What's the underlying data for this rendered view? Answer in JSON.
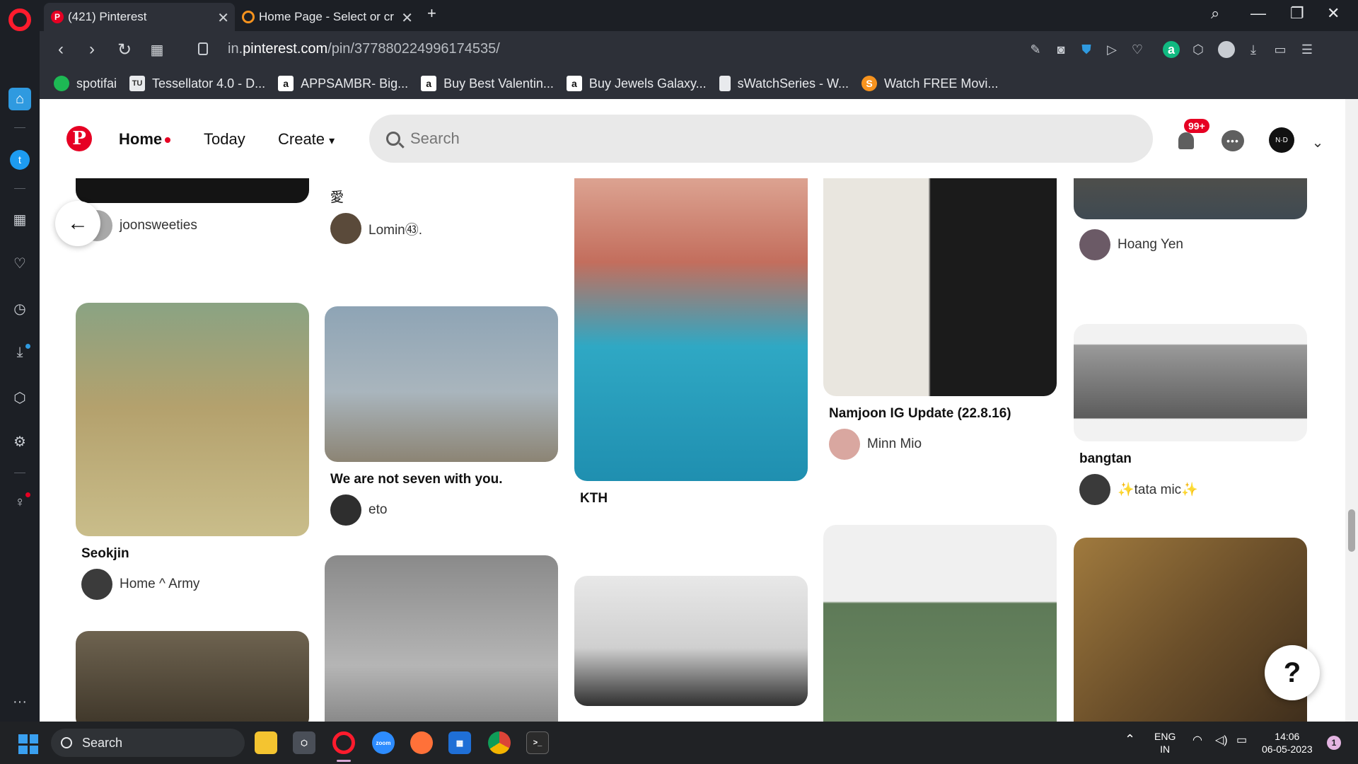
{
  "browser": {
    "tabs": [
      {
        "label": "(421) Pinterest",
        "active": true
      },
      {
        "label": "Home Page - Select or cr",
        "active": false
      }
    ],
    "url_prefix": "in.",
    "url_domain": "pinterest.com",
    "url_path": "/pin/377880224996174535/",
    "bookmarks": [
      {
        "label": "spotifai",
        "icon": "spotify-icon",
        "color": "#1db954"
      },
      {
        "label": "Tessellator 4.0 - D...",
        "icon": "tu-icon",
        "color": "#e8eaed"
      },
      {
        "label": "APPSAMBR- Big...",
        "icon": "amazon-icon",
        "color": "#ffffff"
      },
      {
        "label": "Buy Best Valentin...",
        "icon": "amazon-icon",
        "color": "#ffffff"
      },
      {
        "label": "Buy Jewels Galaxy...",
        "icon": "amazon-icon",
        "color": "#ffffff"
      },
      {
        "label": "sWatchSeries - W...",
        "icon": "page-icon",
        "color": "#e8eaed"
      },
      {
        "label": "Watch FREE Movi...",
        "icon": "s-icon",
        "color": "#f7931e"
      }
    ]
  },
  "pinterest": {
    "nav": {
      "home": "Home",
      "today": "Today",
      "create": "Create"
    },
    "search_placeholder": "Search",
    "notifications_badge": "99+",
    "accent": "#e60023"
  },
  "pins": [
    {
      "id": "c1a",
      "title": "",
      "author": "joonsweeties"
    },
    {
      "id": "c1b",
      "title": "Seokjin",
      "author": "Home ^ Army"
    },
    {
      "id": "c2a",
      "title": "愛",
      "author": "Lomin㊸."
    },
    {
      "id": "c2b",
      "title": "We are not seven with you.",
      "author": "eto"
    },
    {
      "id": "c3a",
      "title": "KTH",
      "author": ""
    },
    {
      "id": "c4a",
      "title": "Namjoon IG Update (22.8.16)",
      "author": "Minn Mio"
    },
    {
      "id": "c5a",
      "title": "",
      "author": "Hoang Yen"
    },
    {
      "id": "c5b",
      "title": "bangtan",
      "author": "✨tata mic✨"
    }
  ],
  "help_label": "?",
  "taskbar": {
    "search_label": "Search",
    "lang_top": "ENG",
    "lang_bottom": "IN",
    "time": "14:06",
    "date": "06-05-2023",
    "notification_count": "1"
  }
}
